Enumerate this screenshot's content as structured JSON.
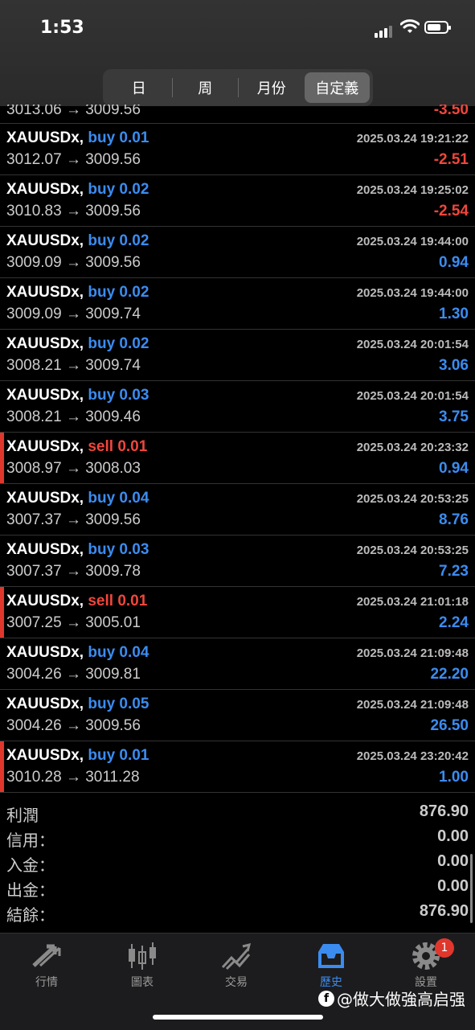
{
  "status": {
    "time": "1:53"
  },
  "periods": {
    "day": "日",
    "week": "周",
    "month": "月份",
    "custom": "自定義"
  },
  "partial_row": {
    "prices": "3013.06 → 3009.56",
    "profit": "-3.50"
  },
  "trades": [
    {
      "symbol": "XAUUSDx,",
      "side": "buy",
      "lot": "buy 0.01",
      "date": "2025.03.24 19:21:22",
      "prices": "3012.07 → 3009.56",
      "profit": "-2.51",
      "marked": false
    },
    {
      "symbol": "XAUUSDx,",
      "side": "buy",
      "lot": "buy 0.02",
      "date": "2025.03.24 19:25:02",
      "prices": "3010.83 → 3009.56",
      "profit": "-2.54",
      "marked": false
    },
    {
      "symbol": "XAUUSDx,",
      "side": "buy",
      "lot": "buy 0.02",
      "date": "2025.03.24 19:44:00",
      "prices": "3009.09 → 3009.56",
      "profit": "0.94",
      "marked": false
    },
    {
      "symbol": "XAUUSDx,",
      "side": "buy",
      "lot": "buy 0.02",
      "date": "2025.03.24 19:44:00",
      "prices": "3009.09 → 3009.74",
      "profit": "1.30",
      "marked": false
    },
    {
      "symbol": "XAUUSDx,",
      "side": "buy",
      "lot": "buy 0.02",
      "date": "2025.03.24 20:01:54",
      "prices": "3008.21 → 3009.74",
      "profit": "3.06",
      "marked": false
    },
    {
      "symbol": "XAUUSDx,",
      "side": "buy",
      "lot": "buy 0.03",
      "date": "2025.03.24 20:01:54",
      "prices": "3008.21 → 3009.46",
      "profit": "3.75",
      "marked": false
    },
    {
      "symbol": "XAUUSDx,",
      "side": "sell",
      "lot": "sell 0.01",
      "date": "2025.03.24 20:23:32",
      "prices": "3008.97 → 3008.03",
      "profit": "0.94",
      "marked": true
    },
    {
      "symbol": "XAUUSDx,",
      "side": "buy",
      "lot": "buy 0.04",
      "date": "2025.03.24 20:53:25",
      "prices": "3007.37 → 3009.56",
      "profit": "8.76",
      "marked": false
    },
    {
      "symbol": "XAUUSDx,",
      "side": "buy",
      "lot": "buy 0.03",
      "date": "2025.03.24 20:53:25",
      "prices": "3007.37 → 3009.78",
      "profit": "7.23",
      "marked": false
    },
    {
      "symbol": "XAUUSDx,",
      "side": "sell",
      "lot": "sell 0.01",
      "date": "2025.03.24 21:01:18",
      "prices": "3007.25 → 3005.01",
      "profit": "2.24",
      "marked": true
    },
    {
      "symbol": "XAUUSDx,",
      "side": "buy",
      "lot": "buy 0.04",
      "date": "2025.03.24 21:09:48",
      "prices": "3004.26 → 3009.81",
      "profit": "22.20",
      "marked": false
    },
    {
      "symbol": "XAUUSDx,",
      "side": "buy",
      "lot": "buy 0.05",
      "date": "2025.03.24 21:09:48",
      "prices": "3004.26 → 3009.56",
      "profit": "26.50",
      "marked": false
    },
    {
      "symbol": "XAUUSDx,",
      "side": "buy",
      "lot": "buy 0.01",
      "date": "2025.03.24 23:20:42",
      "prices": "3010.28 → 3011.28",
      "profit": "1.00",
      "marked": true
    }
  ],
  "summary": [
    {
      "label": "利潤",
      "value": "876.90"
    },
    {
      "label": "信用：",
      "value": "0.00"
    },
    {
      "label": "入金：",
      "value": "0.00"
    },
    {
      "label": "出金：",
      "value": "0.00"
    },
    {
      "label": "結餘：",
      "value": "876.90"
    }
  ],
  "tabs": {
    "quotes": "行情",
    "charts": "圖表",
    "trade": "交易",
    "history": "歷史",
    "settings": "設置",
    "settings_badge": "1"
  },
  "watermark": {
    "fb": "f",
    "text": "@做大做強高启强"
  },
  "colors": {
    "buy": "#3b8cf0",
    "sell": "#f0463c",
    "marker": "#e0372c"
  }
}
